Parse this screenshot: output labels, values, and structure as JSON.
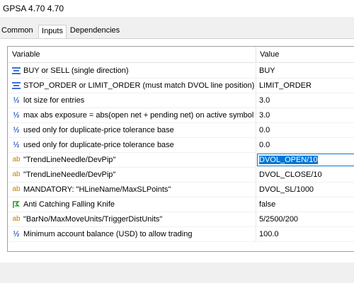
{
  "window": {
    "title": "GPSA 4.70 4.70"
  },
  "tabs": [
    {
      "label": "Common",
      "active": false
    },
    {
      "label": "Inputs",
      "active": true
    },
    {
      "label": "Dependencies",
      "active": false
    }
  ],
  "grid": {
    "header": {
      "variable": "Variable",
      "value": "Value"
    },
    "rows": [
      {
        "icon": "enum-icon",
        "variable": "BUY or SELL (single direction)",
        "value": "BUY"
      },
      {
        "icon": "enum-icon",
        "variable": "STOP_ORDER or LIMIT_ORDER (must match DVOL line position)",
        "value": "LIMIT_ORDER"
      },
      {
        "icon": "fraction-icon",
        "variable": "lot size for entries",
        "value": "3.0"
      },
      {
        "icon": "fraction-icon",
        "variable": "max abs exposure = abs(open net + pending net) on active symbol",
        "value": "3.0"
      },
      {
        "icon": "fraction-icon",
        "variable": "used only for duplicate-price tolerance base",
        "value": "0.0"
      },
      {
        "icon": "fraction-icon",
        "variable": "used only for duplicate-price tolerance base",
        "value": "0.0"
      },
      {
        "icon": "string-icon",
        "variable": "\"TrendLineNeedle/DevPip\"",
        "value": "DVOL_OPEN/10",
        "selected": true
      },
      {
        "icon": "string-icon",
        "variable": "\"TrendLineNeedle/DevPip\"",
        "value": "DVOL_CLOSE/10"
      },
      {
        "icon": "string-icon",
        "variable": "MANDATORY: \"HLineName/MaxSLPoints\"",
        "value": "DVOL_SL/1000"
      },
      {
        "icon": "bool-icon",
        "variable": "Anti Catching Falling Knife",
        "value": "false"
      },
      {
        "icon": "string-icon",
        "variable": "\"BarNo/MaxMoveUnits/TriggerDistUnits\"",
        "value": "5/2500/200"
      },
      {
        "icon": "fraction-icon",
        "variable": "Minimum account balance (USD) to allow trading",
        "value": "100.0"
      }
    ]
  }
}
